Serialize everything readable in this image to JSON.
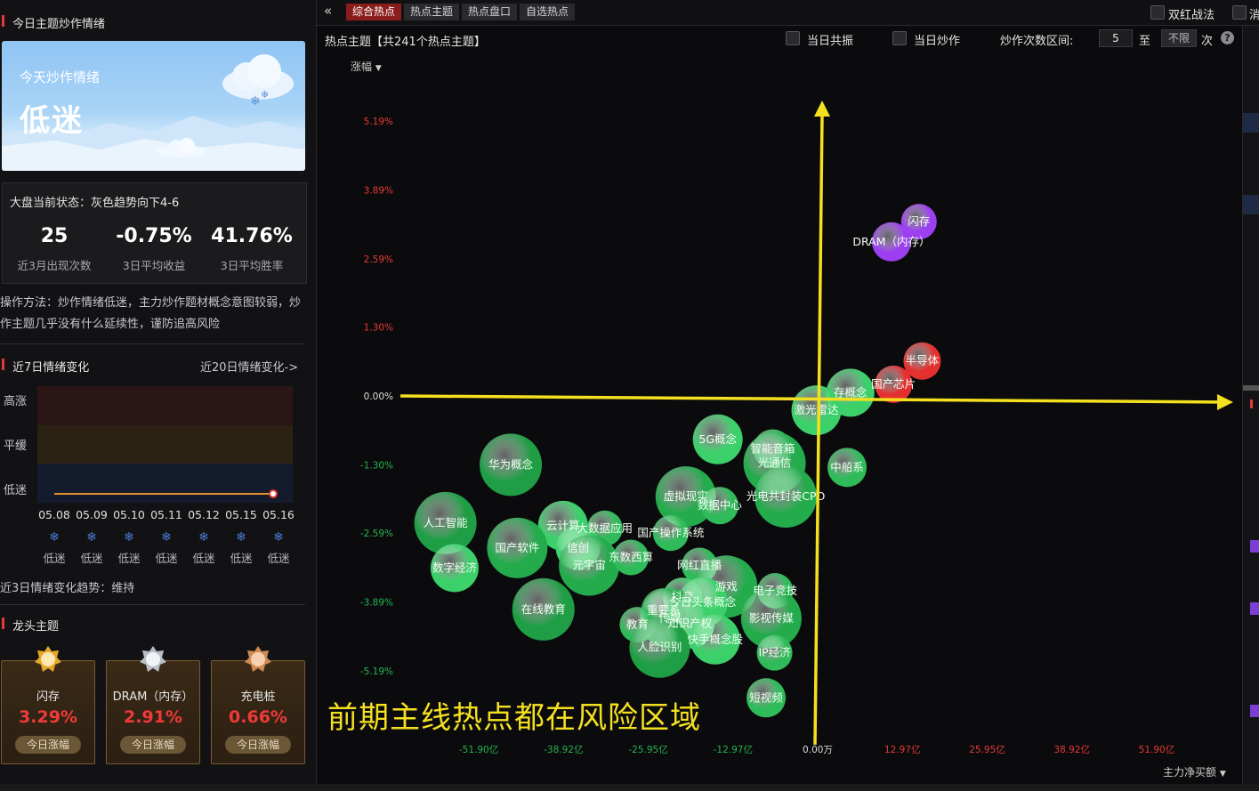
{
  "left": {
    "title": "今日主题炒作情绪",
    "mood": {
      "heading": "今天炒作情绪",
      "value": "低迷"
    },
    "market": {
      "status": "大盘当前状态：灰色趋势向下4-6",
      "stats": [
        {
          "value": "25",
          "label": "近3月出现次数"
        },
        {
          "value": "-0.75%",
          "label": "3日平均收益"
        },
        {
          "value": "41.76%",
          "label": "3日平均胜率"
        }
      ]
    },
    "method": "操作方法：炒作情绪低迷，主力炒作题材概念意图较弱，炒作主题几乎没有什么延续性，谨防追高风险",
    "trend": {
      "title": "近7日情绪变化",
      "link": "近20日情绪变化->",
      "bands": [
        "高涨",
        "平缓",
        "低迷"
      ],
      "dates": [
        "05.08",
        "05.09",
        "05.10",
        "05.11",
        "05.12",
        "05.15",
        "05.16"
      ],
      "states": [
        "低迷",
        "低迷",
        "低迷",
        "低迷",
        "低迷",
        "低迷",
        "低迷"
      ],
      "summary": "近3日情绪变化趋势：维持"
    },
    "leaders": {
      "title": "龙头主题",
      "items": [
        {
          "name": "闪存",
          "pct": "3.29%",
          "btn": "今日涨幅",
          "medal": "#e6a72a"
        },
        {
          "name": "DRAM（内存）",
          "pct": "2.91%",
          "btn": "今日涨幅",
          "medal": "#b9bec6"
        },
        {
          "name": "充电桩",
          "pct": "0.66%",
          "btn": "今日涨幅",
          "medal": "#d08a52"
        }
      ]
    }
  },
  "topbar": {
    "tabs": [
      "综合热点",
      "热点主题",
      "热点盘口",
      "自选热点"
    ],
    "active": 0,
    "right": [
      "双红战法",
      "消"
    ]
  },
  "filter": {
    "title": "热点主题【共241个热点主题】",
    "opt1": "当日共振",
    "opt2": "当日炒作",
    "range_label": "炒作次数区间:",
    "from": "5",
    "to_label": "至",
    "to_value": "不限",
    "unit": "次",
    "help": "?"
  },
  "chart_data": {
    "type": "scatter",
    "ylabel": "涨幅",
    "xlabel": "主力净买额",
    "y_ticks": [
      "5.19%",
      "3.89%",
      "2.59%",
      "1.30%",
      "0.00%",
      "-1.30%",
      "-2.59%",
      "-3.89%",
      "-5.19%"
    ],
    "x_ticks": [
      "-51.90亿",
      "-38.92亿",
      "-25.95亿",
      "-12.97亿",
      "0.00万",
      "12.97亿",
      "25.95亿",
      "38.92亿",
      "51.90亿"
    ],
    "xlim": [
      -60,
      60
    ],
    "ylim": [
      -5.8,
      5.8
    ],
    "points": [
      {
        "label": "闪存",
        "x": 15.5,
        "y": 3.29,
        "r": 20,
        "color": "#9b3ff0"
      },
      {
        "label": "DRAM（内存）",
        "x": 11.3,
        "y": 2.91,
        "r": 22,
        "color": "#9b3ff0"
      },
      {
        "label": "半导体",
        "x": 16.0,
        "y": 0.66,
        "r": 21,
        "color": "#e53030"
      },
      {
        "label": "国产芯片",
        "x": 11.6,
        "y": 0.22,
        "r": 21,
        "color": "#e53030"
      },
      {
        "label": "存概念",
        "x": 5.0,
        "y": 0.06,
        "r": 27,
        "color": "#3bd06a"
      },
      {
        "label": "激光雷达",
        "x": -0.2,
        "y": -0.27,
        "r": 28,
        "color": "#3bd06a"
      },
      {
        "label": "中船系",
        "x": 4.5,
        "y": -1.35,
        "r": 22,
        "color": "#2fbb5a"
      },
      {
        "label": "5G概念",
        "x": -15.3,
        "y": -0.82,
        "r": 28,
        "color": "#3bd06a"
      },
      {
        "label": "智能音箱",
        "x": -6.9,
        "y": -1.0,
        "r": 22,
        "color": "#2fbb5a"
      },
      {
        "label": "光通信",
        "x": -6.6,
        "y": -1.27,
        "r": 35,
        "color": "#23ab4c"
      },
      {
        "label": "光电共封装CPO",
        "x": -4.9,
        "y": -1.9,
        "r": 35,
        "color": "#23ab4c"
      },
      {
        "label": "华为概念",
        "x": -47.0,
        "y": -1.3,
        "r": 35,
        "color": "#1f9e45"
      },
      {
        "label": "虚拟现实",
        "x": -20.2,
        "y": -1.9,
        "r": 34,
        "color": "#23ab4c"
      },
      {
        "label": "数据中心",
        "x": -15.0,
        "y": -2.07,
        "r": 21,
        "color": "#2fbb5a"
      },
      {
        "label": "国产操作系统",
        "x": -22.5,
        "y": -2.59,
        "r": 20,
        "color": "#2fbb5a"
      },
      {
        "label": "人工智能",
        "x": -57.0,
        "y": -2.4,
        "r": 35,
        "color": "#1f9e45"
      },
      {
        "label": "云计算",
        "x": -39.0,
        "y": -2.45,
        "r": 28,
        "color": "#3bd06a"
      },
      {
        "label": "大数据应用",
        "x": -32.6,
        "y": -2.5,
        "r": 20,
        "color": "#2fbb5a"
      },
      {
        "label": "国产软件",
        "x": -46.0,
        "y": -2.87,
        "r": 34,
        "color": "#23ab4c"
      },
      {
        "label": "信创",
        "x": -36.7,
        "y": -2.87,
        "r": 25,
        "color": "#3bd06a"
      },
      {
        "label": "元宇宙",
        "x": -35.0,
        "y": -3.2,
        "r": 34,
        "color": "#23ab4c"
      },
      {
        "label": "东数西算",
        "x": -28.6,
        "y": -3.05,
        "r": 20,
        "color": "#2fbb5a"
      },
      {
        "label": "数字经济",
        "x": -55.6,
        "y": -3.25,
        "r": 27,
        "color": "#3bd06a"
      },
      {
        "label": "网红直播",
        "x": -18.1,
        "y": -3.2,
        "r": 20,
        "color": "#2fbb5a"
      },
      {
        "label": "在线教育",
        "x": -42.0,
        "y": -4.03,
        "r": 35,
        "color": "#1f9e45"
      },
      {
        "label": "游戏",
        "x": -14.0,
        "y": -3.6,
        "r": 35,
        "color": "#23ab4c"
      },
      {
        "label": "电子竞技",
        "x": -6.5,
        "y": -3.68,
        "r": 20,
        "color": "#2fbb5a"
      },
      {
        "label": "抖音",
        "x": -20.7,
        "y": -3.8,
        "r": 22,
        "color": "#3bd06a"
      },
      {
        "label": "今日头条概念",
        "x": -17.6,
        "y": -3.9,
        "r": 28,
        "color": "#3bd06a"
      },
      {
        "label": "传媒",
        "x": -22.6,
        "y": -4.2,
        "r": 34,
        "color": "#23ab4c"
      },
      {
        "label": "重要系",
        "x": -23.6,
        "y": -4.05,
        "r": 25,
        "color": "#23ab4c"
      },
      {
        "label": "知识产权",
        "x": -19.6,
        "y": -4.3,
        "r": 28,
        "color": "#3bd06a"
      },
      {
        "label": "影视传媒",
        "x": -7.1,
        "y": -4.2,
        "r": 34,
        "color": "#23ab4c"
      },
      {
        "label": "教育",
        "x": -27.6,
        "y": -4.32,
        "r": 20,
        "color": "#2fbb5a"
      },
      {
        "label": "快手概念股",
        "x": -15.7,
        "y": -4.6,
        "r": 28,
        "color": "#3bd06a"
      },
      {
        "label": "人脸识别",
        "x": -24.2,
        "y": -4.75,
        "r": 34,
        "color": "#1f9e45"
      },
      {
        "label": "IP经济",
        "x": -6.6,
        "y": -4.85,
        "r": 20,
        "color": "#2fbb5a"
      },
      {
        "label": "短视频",
        "x": -7.9,
        "y": -5.7,
        "r": 22,
        "color": "#2fbb5a"
      }
    ]
  },
  "annotation": "前期主线热点都在风险区域"
}
